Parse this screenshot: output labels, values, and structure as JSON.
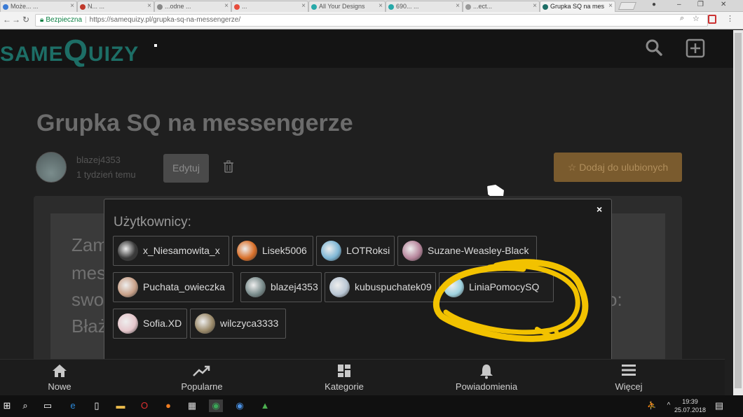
{
  "browser": {
    "tabs": [
      {
        "label": "Może... ..."
      },
      {
        "label": "N... ..."
      },
      {
        "label": "...odne ..."
      },
      {
        "label": "..."
      },
      {
        "label": "All Your Designs"
      },
      {
        "label": "690... ..."
      },
      {
        "label": "...ect..."
      },
      {
        "label": "Grupka SQ na mes"
      }
    ],
    "url_secure_label": "Bezpieczna",
    "url": "https://samequizy.pl/grupka-sq-na-messengerze/"
  },
  "site": {
    "logo_small": "SAME",
    "logo_big": "Q",
    "logo_rest": "UIZY",
    "search_icon": "search-icon",
    "add_icon": "plus-square-icon"
  },
  "post": {
    "title": "Grupka SQ na messengerze",
    "author": "blazej4353",
    "date": "1 tydzień temu",
    "edit_label": "Edytuj",
    "favorite_label": "Dodaj do ulubionych",
    "bg_text_lines": [
      "Zam",
      "mes",
      "swo",
      "Błaż"
    ],
    "bg_text_right": "o:"
  },
  "modal": {
    "title": "Użytkownicy:",
    "close_label": "×",
    "users": [
      {
        "name": "x_Niesamowita_x",
        "color": "#3a3a3a"
      },
      {
        "name": "Lisek5006",
        "color": "#d9702a"
      },
      {
        "name": "LOTRoksi",
        "color": "#7fb7d6"
      },
      {
        "name": "Suzane-Weasley-Black",
        "color": "#b7869c"
      },
      {
        "name": "Puchata_owieczka",
        "color": "#c9a28a"
      },
      {
        "name": "blazej4353",
        "color": "#7a8c8c"
      },
      {
        "name": "kubuspuchatek09",
        "color": "#b9c6d4"
      },
      {
        "name": "LiniaPomocySQ",
        "color": "#9fd3e0"
      },
      {
        "name": "Sofia.XD",
        "color": "#e6c7cc"
      },
      {
        "name": "wilczyca3333",
        "color": "#9b8a6a"
      }
    ]
  },
  "bottom_nav": [
    {
      "label": "Nowe",
      "icon": "home-icon"
    },
    {
      "label": "Popularne",
      "icon": "trending-icon"
    },
    {
      "label": "Kategorie",
      "icon": "grid-icon"
    },
    {
      "label": "Powiadomienia",
      "icon": "bell-icon"
    },
    {
      "label": "Więcej",
      "icon": "menu-icon"
    }
  ],
  "taskbar": {
    "time": "19:39",
    "date": "25.07.2018"
  },
  "colors": {
    "highlight": "#f2c200",
    "logo": "#1d6e66",
    "favorite": "#7a5b2e"
  }
}
